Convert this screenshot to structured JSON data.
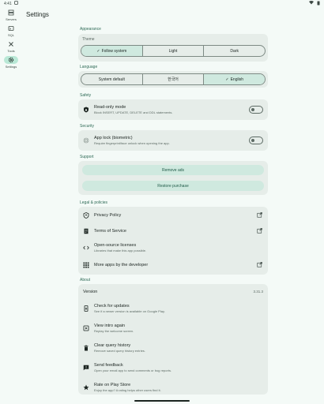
{
  "status_bar": {
    "time": "4:41"
  },
  "rail": {
    "items": [
      {
        "label": "Servers",
        "icon": "servers-icon"
      },
      {
        "label": "SQL",
        "icon": "sql-icon"
      },
      {
        "label": "Tools",
        "icon": "tools-icon"
      },
      {
        "label": "Settings",
        "icon": "gear-icon",
        "active": true
      }
    ]
  },
  "page": {
    "title": "Settings"
  },
  "appearance": {
    "section": "Appearance",
    "theme_label": "Theme",
    "options": [
      "Follow system",
      "Light",
      "Dark"
    ],
    "selected": "Follow system"
  },
  "language": {
    "section": "Language",
    "options": [
      "System default",
      "한국어",
      "English"
    ],
    "selected": "English"
  },
  "safety": {
    "section": "Safety",
    "title": "Read-only mode",
    "sub": "Block INSERT, UPDATE, DELETE and DDL statements."
  },
  "security": {
    "section": "Security",
    "title": "App lock (biometric)",
    "sub": "Require fingerprint/face unlock when opening the app."
  },
  "support": {
    "section": "Support",
    "remove_ads": "Remove ads",
    "restore": "Restore purchase"
  },
  "legal": {
    "section": "Legal & policies",
    "items": [
      {
        "title": "Privacy Policy",
        "sub": ""
      },
      {
        "title": "Terms of Service",
        "sub": ""
      },
      {
        "title": "Open-source licenses",
        "sub": "Libraries that make this app possible."
      },
      {
        "title": "More apps by the developer",
        "sub": ""
      }
    ]
  },
  "about": {
    "section": "About",
    "version_label": "Version",
    "version_value": "3.31.3",
    "items": [
      {
        "title": "Check for updates",
        "sub": "See if a newer version is available on Google Play."
      },
      {
        "title": "View intro again",
        "sub": "Replay the welcome screen."
      },
      {
        "title": "Clear query history",
        "sub": "Remove saved query history entries."
      },
      {
        "title": "Send feedback",
        "sub": "Open your email app to send comments or bug reports."
      },
      {
        "title": "Rate on Play Store",
        "sub": "Enjoy the app? A rating helps other users find it."
      }
    ]
  },
  "colors": {
    "accent": "#2f6b57",
    "surface": "#e6ede9",
    "tonal": "#cfe9df"
  }
}
